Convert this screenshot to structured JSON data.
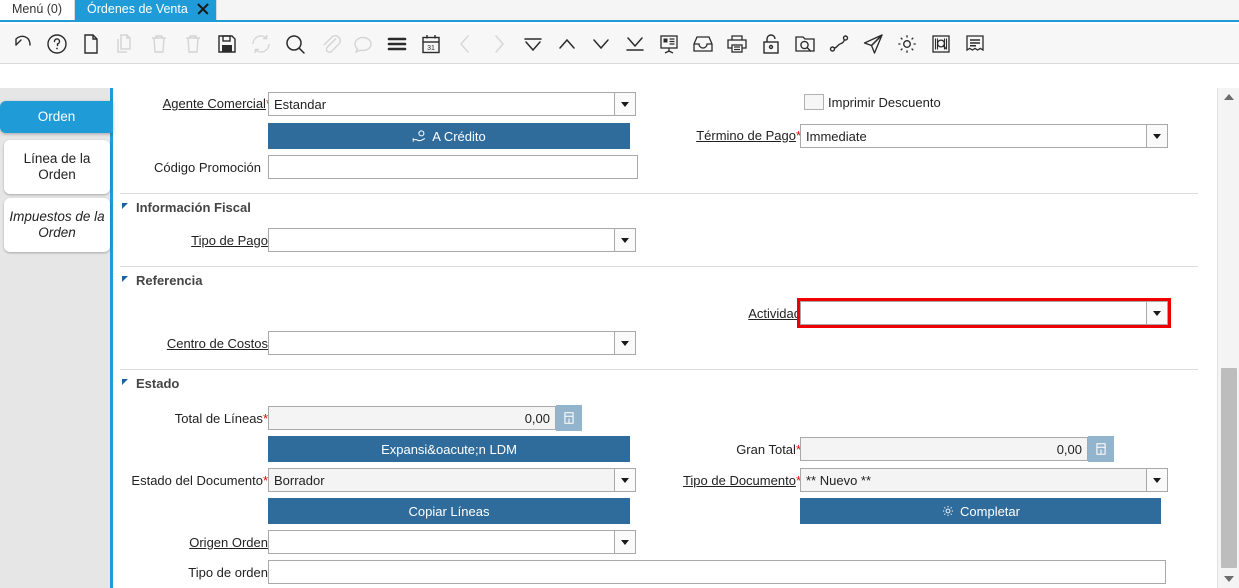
{
  "window": {
    "tabs": [
      {
        "label": "Menú (0)",
        "active": false,
        "closable": false
      },
      {
        "label": "Órdenes de Venta",
        "active": true,
        "closable": true
      }
    ]
  },
  "toolbar": {
    "items": [
      {
        "name": "undo-icon",
        "title": "Deshacer",
        "enabled": true
      },
      {
        "name": "help-icon",
        "title": "Ayuda",
        "enabled": true
      },
      {
        "name": "new-record-icon",
        "title": "Nuevo",
        "enabled": true
      },
      {
        "name": "copy-record-icon",
        "title": "Copiar",
        "enabled": false
      },
      {
        "name": "delete-icon",
        "title": "Eliminar",
        "enabled": false
      },
      {
        "name": "delete-selection-icon",
        "title": "Eliminar selección",
        "enabled": false
      },
      {
        "name": "save-icon",
        "title": "Guardar",
        "enabled": true
      },
      {
        "name": "refresh-icon",
        "title": "Refrescar",
        "enabled": false
      },
      {
        "name": "search-icon",
        "title": "Buscar",
        "enabled": true
      },
      {
        "name": "attachment-icon",
        "title": "Adjunto",
        "enabled": false
      },
      {
        "name": "chat-icon",
        "title": "Notas",
        "enabled": false
      },
      {
        "name": "grid-toggle-icon",
        "title": "Vista de cuadrícula",
        "enabled": true
      },
      {
        "name": "calendar-icon",
        "title": "Calendario",
        "enabled": true
      },
      {
        "name": "previous-record-icon",
        "title": "Anterior",
        "enabled": false
      },
      {
        "name": "next-record-icon",
        "title": "Siguiente",
        "enabled": false
      },
      {
        "name": "first-record-icon",
        "title": "Primero",
        "enabled": true
      },
      {
        "name": "previous-page-icon",
        "title": "Arriba",
        "enabled": true
      },
      {
        "name": "next-page-icon",
        "title": "Abajo",
        "enabled": true
      },
      {
        "name": "last-record-icon",
        "title": "Último",
        "enabled": true
      },
      {
        "name": "report-icon",
        "title": "Reporte",
        "enabled": true
      },
      {
        "name": "archive-icon",
        "title": "Archivo",
        "enabled": true
      },
      {
        "name": "print-icon",
        "title": "Imprimir",
        "enabled": true
      },
      {
        "name": "lock-icon",
        "title": "Bloquear",
        "enabled": true
      },
      {
        "name": "zoom-across-icon",
        "title": "Zoom",
        "enabled": true
      },
      {
        "name": "workflow-icon",
        "title": "Flujo de trabajo",
        "enabled": true
      },
      {
        "name": "send-icon",
        "title": "Enviar",
        "enabled": true
      },
      {
        "name": "gear-icon",
        "title": "Preferencias",
        "enabled": true
      },
      {
        "name": "barcode-zoom-icon",
        "title": "Código de barras",
        "enabled": true
      },
      {
        "name": "document-lines-icon",
        "title": "Documento",
        "enabled": true
      }
    ]
  },
  "sidebar": {
    "items": [
      {
        "label": "Orden",
        "selected": true
      },
      {
        "label": "Línea de la Orden",
        "selected": false
      },
      {
        "label": "Impuestos de la Orden",
        "selected": false
      }
    ]
  },
  "form": {
    "agente_comercial": {
      "label": "Agente Comercial",
      "required": true,
      "value": "Estandar"
    },
    "a_credito_button": {
      "label": "A Crédito",
      "icon": "hand-coin-icon"
    },
    "codigo_promocion": {
      "label": "Código Promoción",
      "value": ""
    },
    "imprimir_descuento": {
      "label": "Imprimir Descuento",
      "checked": false
    },
    "termino_de_pago": {
      "label": "Término de Pago",
      "required": true,
      "value": "Immediate"
    }
  },
  "sections": {
    "informacion_fiscal": {
      "title": "Información Fiscal",
      "tipo_de_pago": {
        "label": "Tipo de Pago",
        "value": ""
      }
    },
    "referencia": {
      "title": "Referencia",
      "actividad": {
        "label": "Actividad",
        "value": "",
        "highlighted": true,
        "highlight_color": "#ee0000"
      },
      "centro_de_costos": {
        "label": "Centro de Costos",
        "value": ""
      }
    },
    "estado": {
      "title": "Estado",
      "total_de_lineas": {
        "label": "Total de Líneas",
        "required": true,
        "value": "0,00",
        "readonly": true
      },
      "expansion_ldm_button": {
        "label": "Expansi&oacute;n LDM"
      },
      "estado_del_documento": {
        "label": "Estado del Documento",
        "required": true,
        "value": "Borrador"
      },
      "copiar_lineas_button": {
        "label": "Copiar Líneas"
      },
      "origen_orden": {
        "label": "Origen Orden",
        "value": ""
      },
      "tipo_de_orden": {
        "label": "Tipo de orden",
        "value": ""
      },
      "gran_total": {
        "label": "Gran Total",
        "required": true,
        "value": "0,00",
        "readonly": true
      },
      "tipo_de_documento": {
        "label": "Tipo de Documento",
        "required": true,
        "value": "** Nuevo **"
      },
      "completar_button": {
        "label": "Completar",
        "icon": "gear-icon"
      }
    }
  },
  "scrollbar": {
    "orientation": "vertical",
    "position_percent": 60
  },
  "colors": {
    "accent": "#1f9bd8",
    "button_blue": "#2f6c9b",
    "required_star": "#e20000",
    "highlight": "#ee0000"
  }
}
